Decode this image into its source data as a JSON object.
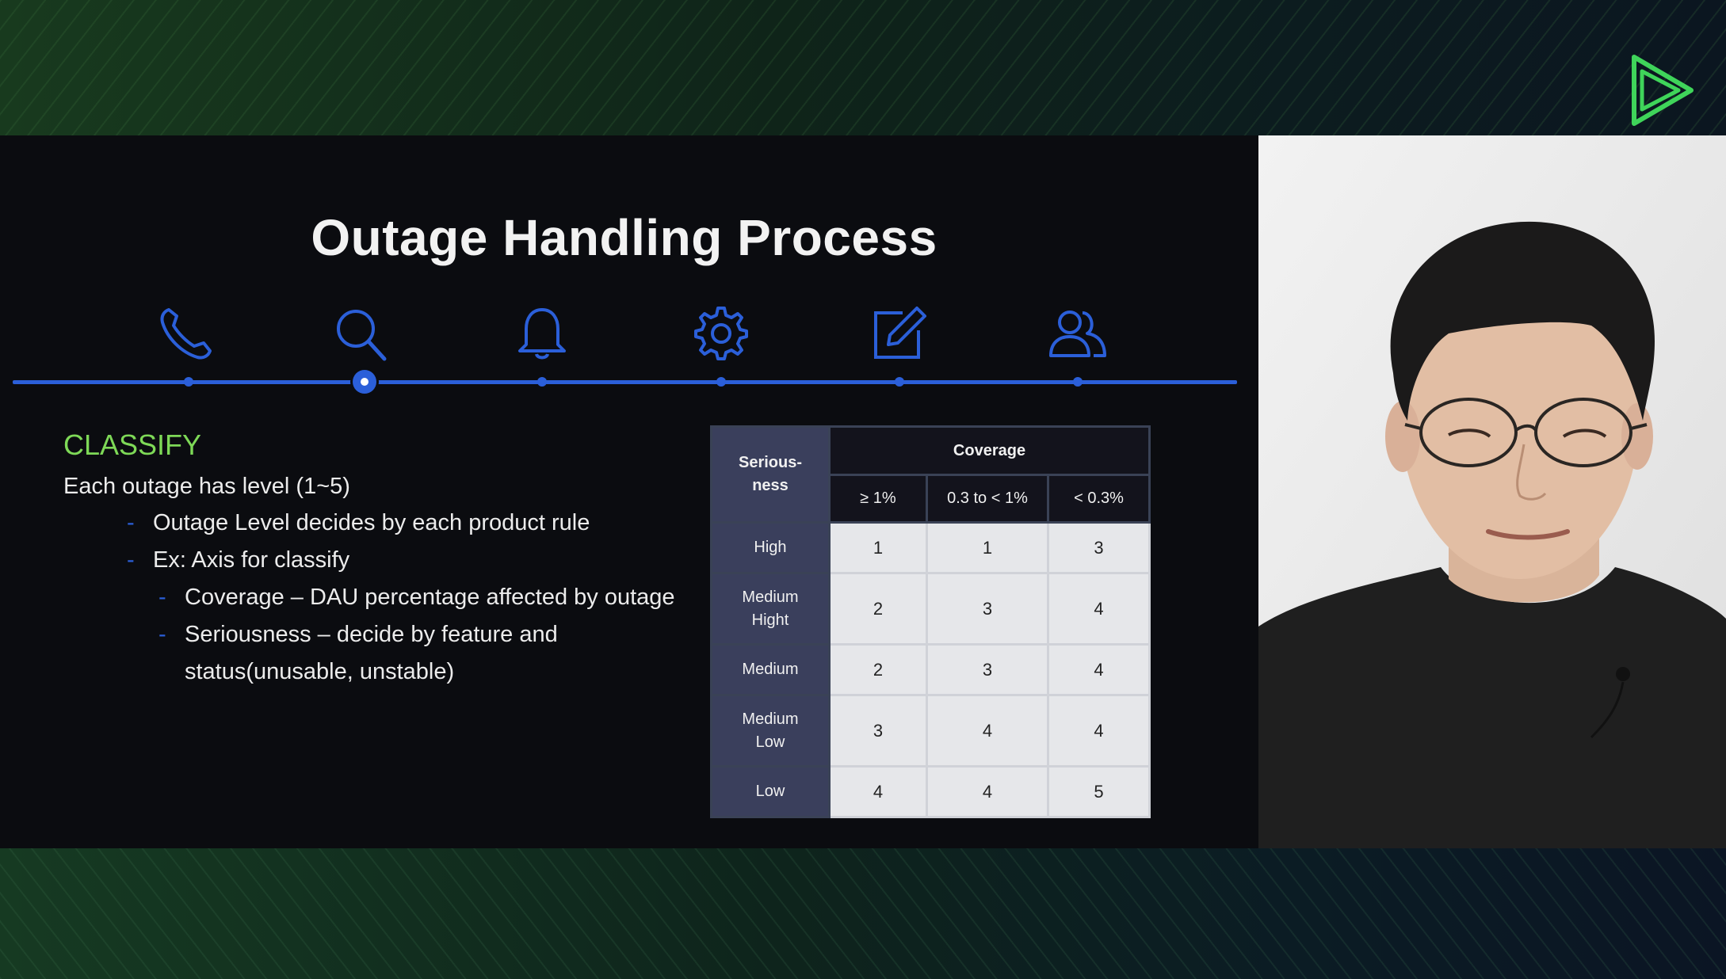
{
  "slide": {
    "title": "Outage Handling Process",
    "steps": [
      {
        "icon": "phone-icon",
        "active": false
      },
      {
        "icon": "search-icon",
        "active": true
      },
      {
        "icon": "bell-icon",
        "active": false
      },
      {
        "icon": "gear-icon",
        "active": false
      },
      {
        "icon": "edit-icon",
        "active": false
      },
      {
        "icon": "users-icon",
        "active": false
      }
    ],
    "section_heading": "CLASSIFY",
    "intro": "Each outage has level (1~5)",
    "bullets": [
      {
        "level": 1,
        "text": "Outage Level decides by each product rule"
      },
      {
        "level": 1,
        "text": "Ex: Axis for classify"
      },
      {
        "level": 2,
        "text": "Coverage – DAU percentage affected by outage"
      },
      {
        "level": 2,
        "text": "Seriousness – decide by feature and"
      },
      {
        "level": 2,
        "text": "status(unusable, unstable)",
        "continuation": true
      }
    ],
    "bullet_marker": "-",
    "table": {
      "corner_label_line1": "Serious-",
      "corner_label_line2": "ness",
      "group_header": "Coverage",
      "columns": [
        "≥ 1%",
        "0.3 to < 1%",
        "< 0.3%"
      ],
      "rows": [
        {
          "label_line1": "High",
          "label_line2": "",
          "values": [
            "1",
            "1",
            "3"
          ]
        },
        {
          "label_line1": "Medium",
          "label_line2": "Hight",
          "values": [
            "2",
            "3",
            "4"
          ]
        },
        {
          "label_line1": "Medium",
          "label_line2": "",
          "values": [
            "2",
            "3",
            "4"
          ]
        },
        {
          "label_line1": "Medium",
          "label_line2": "Low",
          "values": [
            "3",
            "4",
            "4"
          ]
        },
        {
          "label_line1": "Low",
          "label_line2": "",
          "values": [
            "4",
            "4",
            "5"
          ]
        }
      ]
    }
  },
  "colors": {
    "accent_blue": "#2b5fd9",
    "classify_green": "#7ed957",
    "logo_green": "#3fd45a"
  },
  "logo": {
    "icon": "play-logo-icon"
  },
  "video": {
    "subject": "presenter-webcam"
  }
}
